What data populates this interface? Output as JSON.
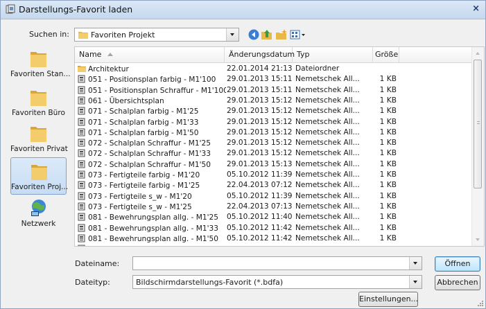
{
  "window": {
    "title": "Darstellungs-Favorit laden",
    "close_glyph": "×"
  },
  "toolbar": {
    "lookin_label": "Suchen in:",
    "lookin_value": "Favoriten Projekt",
    "icons": [
      "back-icon",
      "up-folder-icon",
      "new-folder-icon",
      "view-menu-icon"
    ]
  },
  "places": [
    {
      "label": "Favoriten Stan...",
      "icon": "folder-icon"
    },
    {
      "label": "Favoriten Büro",
      "icon": "folder-icon"
    },
    {
      "label": "Favoriten Privat",
      "icon": "folder-icon"
    },
    {
      "label": "Favoriten Proj...",
      "icon": "folder-icon",
      "selected": true
    },
    {
      "label": "Netzwerk",
      "icon": "network-icon"
    }
  ],
  "columns": {
    "name": "Name",
    "date": "Änderungsdatum",
    "type": "Typ",
    "size": "Größe"
  },
  "files": [
    {
      "name": "Architektur",
      "date": "22.01.2014 21:13",
      "type": "Dateiordner",
      "size": "",
      "icon": "folder-icon"
    },
    {
      "name": "051 - Positionsplan farbig - M1'100",
      "date": "29.01.2013 15:11",
      "type": "Nemetschek All...",
      "size": "1 KB",
      "icon": "favorite-file-icon"
    },
    {
      "name": "051 - Positionsplan Schraffur - M1'100",
      "date": "29.01.2013 15:11",
      "type": "Nemetschek All...",
      "size": "1 KB",
      "icon": "favorite-file-icon"
    },
    {
      "name": "061 - Übersichtsplan",
      "date": "29.01.2013 15:12",
      "type": "Nemetschek All...",
      "size": "1 KB",
      "icon": "favorite-file-icon"
    },
    {
      "name": "071 - Schalplan farbig - M1'25",
      "date": "29.01.2013 15:12",
      "type": "Nemetschek All...",
      "size": "1 KB",
      "icon": "favorite-file-icon"
    },
    {
      "name": "071 - Schalplan farbig - M1'33",
      "date": "29.01.2013 15:12",
      "type": "Nemetschek All...",
      "size": "1 KB",
      "icon": "favorite-file-icon"
    },
    {
      "name": "071 - Schalplan farbig - M1'50",
      "date": "29.01.2013 15:12",
      "type": "Nemetschek All...",
      "size": "1 KB",
      "icon": "favorite-file-icon"
    },
    {
      "name": "072 - Schalplan Schraffur - M1'25",
      "date": "29.01.2013 15:12",
      "type": "Nemetschek All...",
      "size": "1 KB",
      "icon": "favorite-file-icon"
    },
    {
      "name": "072 - Schalplan Schraffur - M1'33",
      "date": "29.01.2013 15:12",
      "type": "Nemetschek All...",
      "size": "1 KB",
      "icon": "favorite-file-icon"
    },
    {
      "name": "072 - Schalplan Schraffur - M1'50",
      "date": "29.01.2013 15:13",
      "type": "Nemetschek All...",
      "size": "1 KB",
      "icon": "favorite-file-icon"
    },
    {
      "name": "073 - Fertigteile farbig - M1'20",
      "date": "05.10.2012 11:39",
      "type": "Nemetschek All...",
      "size": "1 KB",
      "icon": "favorite-file-icon"
    },
    {
      "name": "073 - Fertigteile farbig - M1'25",
      "date": "22.04.2013 07:12",
      "type": "Nemetschek All...",
      "size": "1 KB",
      "icon": "favorite-file-icon"
    },
    {
      "name": "073 - Fertigteile s_w - M1'20",
      "date": "05.10.2012 11:39",
      "type": "Nemetschek All...",
      "size": "1 KB",
      "icon": "favorite-file-icon"
    },
    {
      "name": "073 - Fertigteile s_w - M1'25",
      "date": "22.04.2013 07:13",
      "type": "Nemetschek All...",
      "size": "1 KB",
      "icon": "favorite-file-icon"
    },
    {
      "name": "081 - Bewehrungsplan allg. - M1'25",
      "date": "05.10.2012 11:40",
      "type": "Nemetschek All...",
      "size": "1 KB",
      "icon": "favorite-file-icon"
    },
    {
      "name": "081 - Bewehrungsplan allg. - M1'33",
      "date": "05.10.2012 11:42",
      "type": "Nemetschek All...",
      "size": "1 KB",
      "icon": "favorite-file-icon"
    },
    {
      "name": "081 - Bewehrungsplan allg. - M1'50",
      "date": "05.10.2012 11:42",
      "type": "Nemetschek All...",
      "size": "1 KB",
      "icon": "favorite-file-icon"
    }
  ],
  "filename": {
    "label": "Dateiname:",
    "value": ""
  },
  "filetype": {
    "label": "Dateityp:",
    "value": "Bildschirmdarstellungs-Favorit (*.bdfa)"
  },
  "buttons": {
    "open": "Öffnen",
    "cancel": "Abbrechen",
    "settings": "Einstellungen..."
  },
  "colors": {
    "title_gradient_top": "#dbe8f6",
    "title_gradient_bottom": "#c5d8ee",
    "folder": "#e8b94a",
    "selection": "#c7dcf3",
    "close_glyph": "#1e3f6e"
  }
}
